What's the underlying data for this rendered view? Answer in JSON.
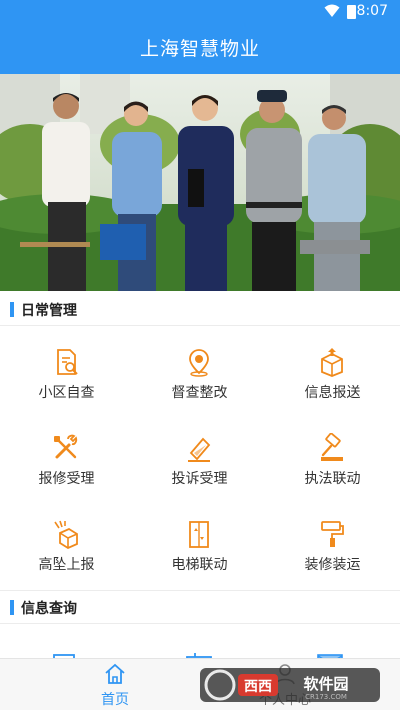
{
  "status_bar": {
    "time": "8:07"
  },
  "app_bar": {
    "title": "上海智慧物业"
  },
  "banner": {
    "alt": "物业服务团队"
  },
  "sections": {
    "daily": {
      "title": "日常管理",
      "items": [
        {
          "label": "小区自查",
          "icon": "document-search-icon"
        },
        {
          "label": "督查整改",
          "icon": "location-pin-icon"
        },
        {
          "label": "信息报送",
          "icon": "upload-box-icon"
        },
        {
          "label": "报修受理",
          "icon": "repair-tools-icon"
        },
        {
          "label": "投诉受理",
          "icon": "complaint-edit-icon"
        },
        {
          "label": "执法联动",
          "icon": "gavel-icon"
        },
        {
          "label": "高坠上报",
          "icon": "falling-box-icon"
        },
        {
          "label": "电梯联动",
          "icon": "elevator-icon"
        },
        {
          "label": "装修装运",
          "icon": "paint-roller-icon"
        }
      ]
    },
    "query": {
      "title": "信息查询"
    }
  },
  "bottom_nav": {
    "home": "首页",
    "profile": "个人中心"
  },
  "colors": {
    "primary": "#2f95f3",
    "icon_orange": "#f08a1c",
    "text": "#333333"
  },
  "watermark": {
    "brand": "西西软件园",
    "url": "CR173.COM"
  }
}
